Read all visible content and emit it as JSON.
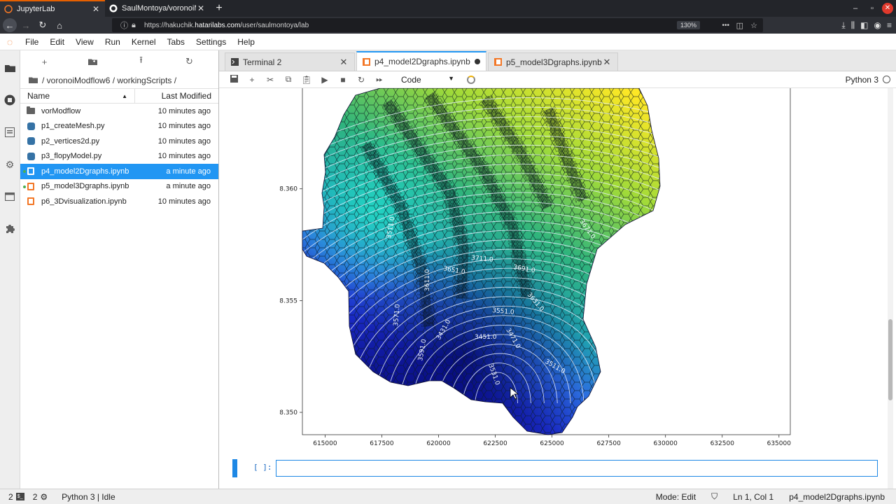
{
  "browser": {
    "tabs": [
      {
        "title": "JupyterLab",
        "active": true
      },
      {
        "title": "SaulMontoya/voronoiMc",
        "active": false
      }
    ],
    "url_prefix": "https://hakuchik.",
    "url_host": "hatarilabs.com",
    "url_path": "/user/saulmontoya/lab",
    "zoom": "130%"
  },
  "menu": [
    "File",
    "Edit",
    "View",
    "Run",
    "Kernel",
    "Tabs",
    "Settings",
    "Help"
  ],
  "filebrowser": {
    "breadcrumb": "/ voronoiModflow6 / workingScripts /",
    "col_name": "Name",
    "col_modified": "Last Modified",
    "files": [
      {
        "name": "vorModflow",
        "type": "folder",
        "modified": "10 minutes ago",
        "selected": false,
        "running": false
      },
      {
        "name": "p1_createMesh.py",
        "type": "python",
        "modified": "10 minutes ago",
        "selected": false,
        "running": false
      },
      {
        "name": "p2_vertices2d.py",
        "type": "python",
        "modified": "10 minutes ago",
        "selected": false,
        "running": false
      },
      {
        "name": "p3_flopyModel.py",
        "type": "python",
        "modified": "10 minutes ago",
        "selected": false,
        "running": false
      },
      {
        "name": "p4_model2Dgraphs.ipynb",
        "type": "notebook",
        "modified": "a minute ago",
        "selected": true,
        "running": true
      },
      {
        "name": "p5_model3Dgraphs.ipynb",
        "type": "notebook",
        "modified": "a minute ago",
        "selected": false,
        "running": true
      },
      {
        "name": "p6_3Dvisualization.ipynb",
        "type": "notebook",
        "modified": "10 minutes ago",
        "selected": false,
        "running": false
      }
    ]
  },
  "doctabs": [
    {
      "label": "Terminal 2",
      "type": "terminal",
      "active": false
    },
    {
      "label": "p4_model2Dgraphs.ipynb",
      "type": "notebook",
      "active": true,
      "unsaved": true
    },
    {
      "label": "p5_model3Dgraphs.ipynb",
      "type": "notebook",
      "active": false
    }
  ],
  "notebook": {
    "cell_type": "Code",
    "kernel": "Python 3",
    "prompt": "[ ]:"
  },
  "chart_data": {
    "type": "heatmap",
    "title": "",
    "xlabel": "",
    "ylabel": "",
    "xlim": [
      614000,
      635500
    ],
    "ylim": [
      8349000,
      8364500
    ],
    "x_ticks": [
      615000,
      617500,
      620000,
      622500,
      625000,
      627500,
      630000,
      632500,
      635000
    ],
    "x_tick_labels": [
      "615000",
      "617500",
      "620000",
      "622500",
      "625000",
      "627500",
      "630000",
      "632500",
      "635000"
    ],
    "y_ticks": [
      8350000,
      8355000,
      8360000
    ],
    "y_tick_labels": [
      "8.350",
      "8.355",
      "8.360"
    ],
    "contour_labels": [
      "3511.0",
      "3651.0",
      "3711.0",
      "3691.0",
      "3631.0",
      "3611.0",
      "3571.0",
      "3551.0",
      "3511.0",
      "3471.0",
      "3451.0",
      "3431.0",
      "3531.0",
      "3591.0",
      "3671.0"
    ],
    "colormap": "viridis"
  },
  "status": {
    "terminals": "2",
    "kernels": "2",
    "kernel_state": "Python 3 | Idle",
    "mode": "Mode: Edit",
    "cursor": "Ln 1, Col 1",
    "file": "p4_model2Dgraphs.ipynb"
  },
  "colors": {
    "accent": "#2196f3",
    "jupyter_orange": "#f37726",
    "browser_dark": "#2f3137"
  }
}
